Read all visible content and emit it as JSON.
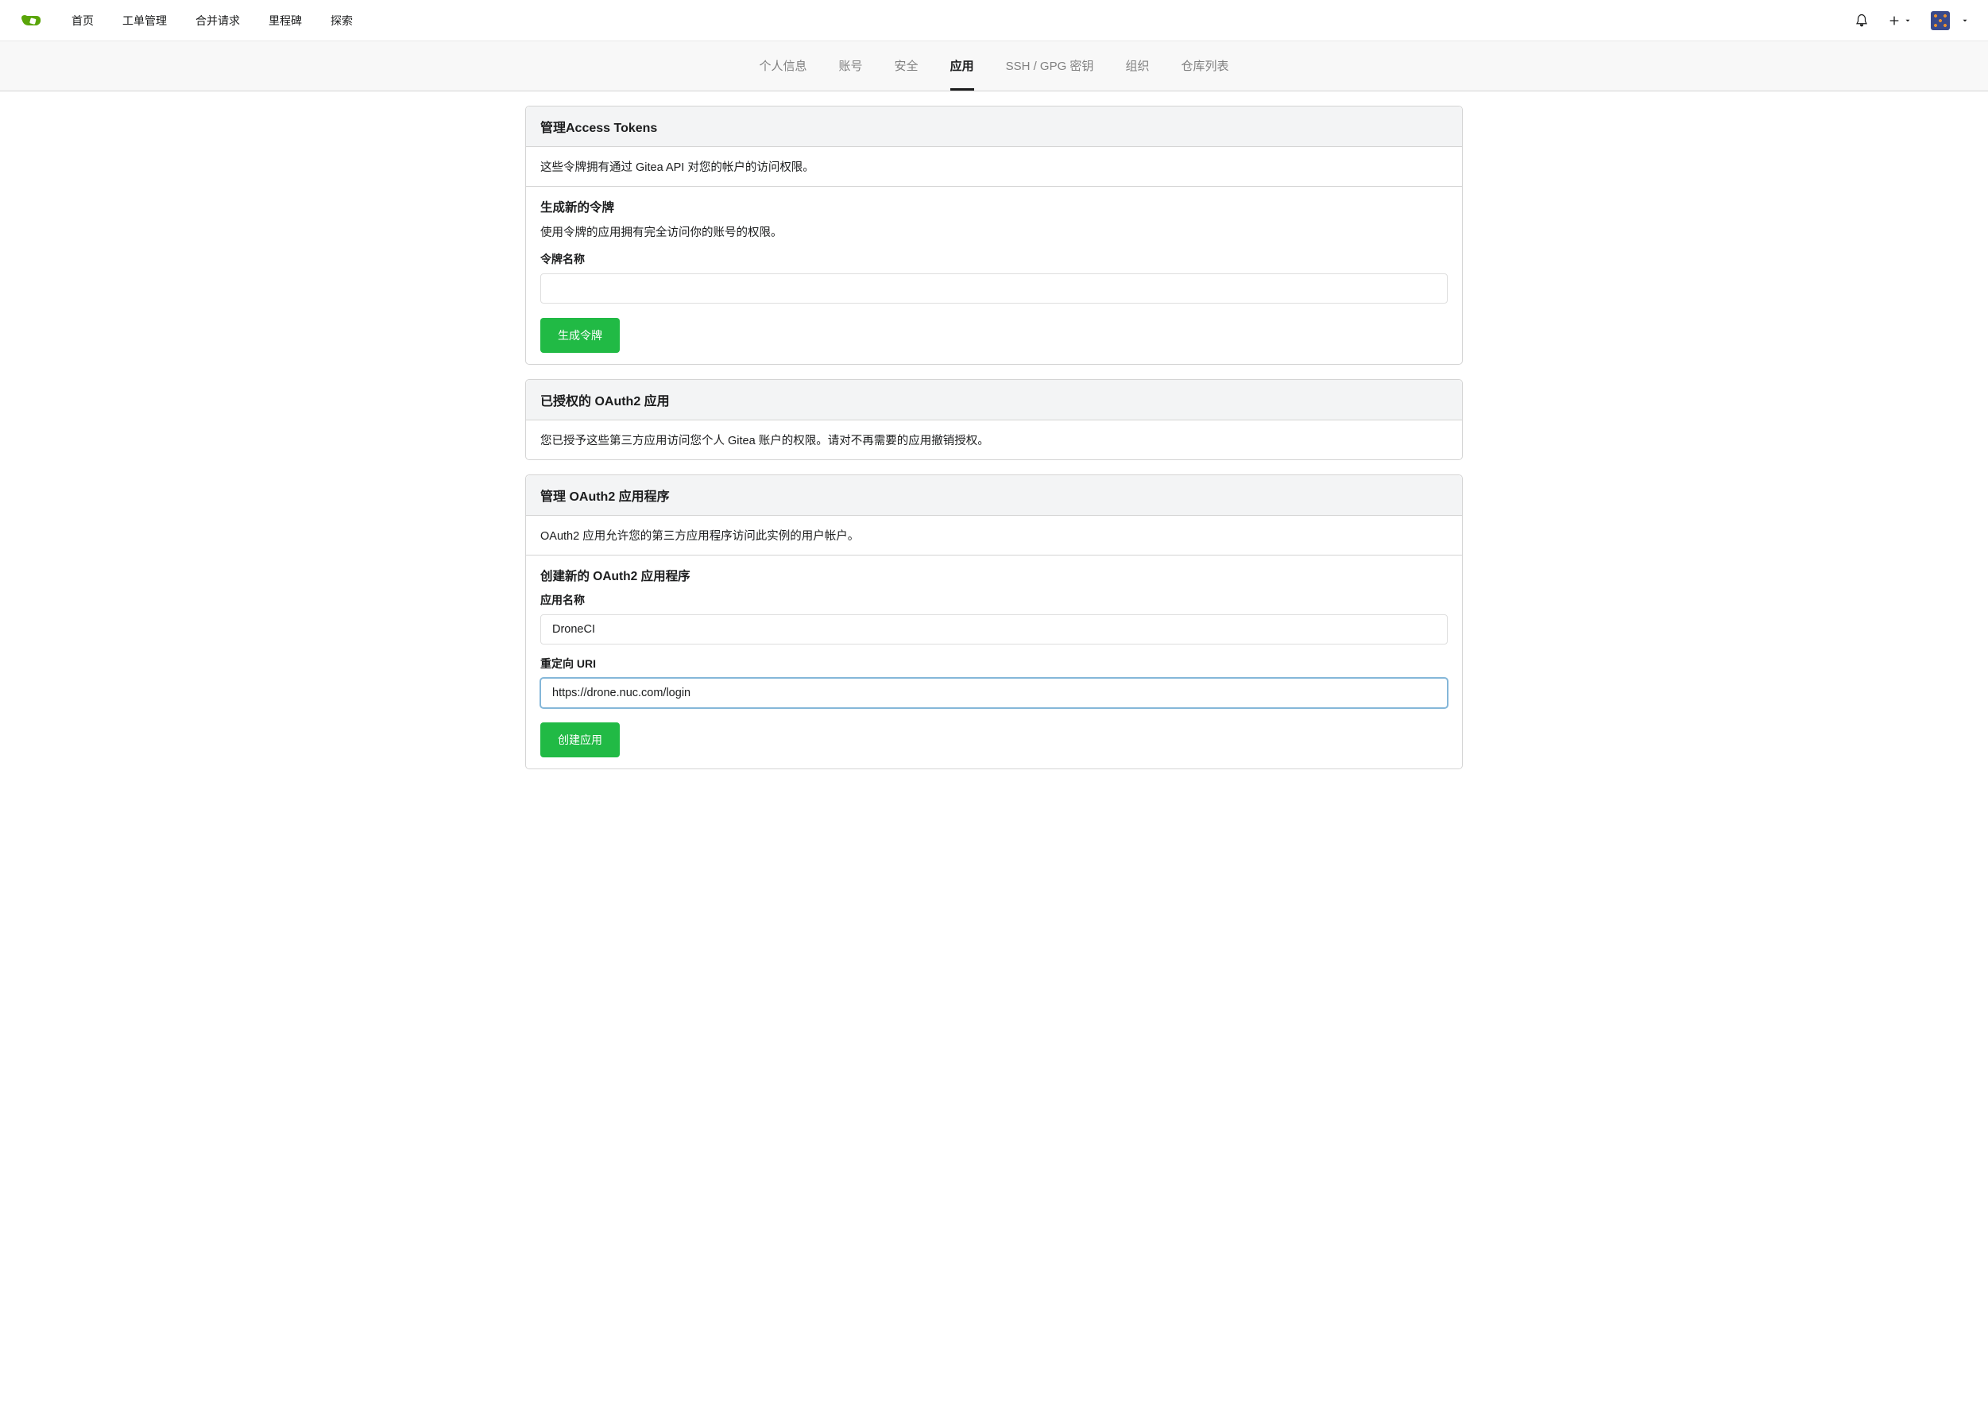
{
  "nav": {
    "links": {
      "home": "首页",
      "issues": "工单管理",
      "pulls": "合并请求",
      "milestones": "里程碑",
      "explore": "探索"
    }
  },
  "subnav": {
    "profile": "个人信息",
    "account": "账号",
    "security": "安全",
    "applications": "应用",
    "ssh": "SSH / GPG 密钥",
    "organizations": "组织",
    "repositories": "仓库列表"
  },
  "tokens": {
    "header": "管理Access Tokens",
    "desc": "这些令牌拥有通过 Gitea API 对您的帐户的访问权限。",
    "generate_header": "生成新的令牌",
    "generate_desc": "使用令牌的应用拥有完全访问你的账号的权限。",
    "name_label": "令牌名称",
    "name_value": "",
    "button": "生成令牌"
  },
  "authorized": {
    "header": "已授权的 OAuth2 应用",
    "desc": "您已授予这些第三方应用访问您个人 Gitea 账户的权限。请对不再需要的应用撤销授权。"
  },
  "oauth": {
    "header": "管理 OAuth2 应用程序",
    "desc": "OAuth2 应用允许您的第三方应用程序访问此实例的用户帐户。",
    "create_header": "创建新的 OAuth2 应用程序",
    "name_label": "应用名称",
    "name_value": "DroneCI",
    "uri_label": "重定向 URI",
    "uri_value": "https://drone.nuc.com/login",
    "button": "创建应用"
  }
}
